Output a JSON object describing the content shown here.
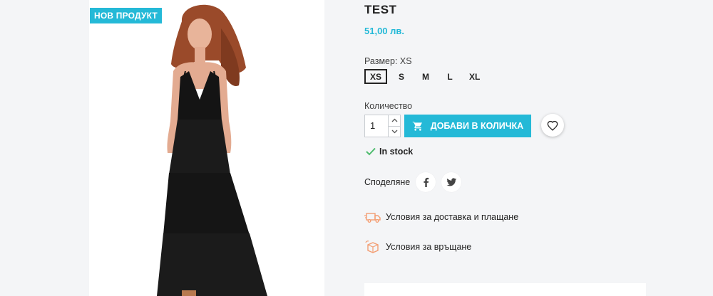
{
  "product": {
    "flag": "НОВ ПРОДУКТ",
    "title": "TEST",
    "price": "51,00 лв."
  },
  "size": {
    "label": "Размер: XS",
    "options": [
      "XS",
      "S",
      "M",
      "L",
      "XL"
    ],
    "selected": "XS"
  },
  "quantity": {
    "label": "Количество",
    "value": "1"
  },
  "cart": {
    "add_label": "ДОБАВИ В КОЛИЧКА"
  },
  "stock": {
    "label": "In stock"
  },
  "share": {
    "label": "Споделяне"
  },
  "reassurance": [
    {
      "label": "Условия за доставка и плащане"
    },
    {
      "label": "Условия за връщане"
    }
  ],
  "icons": {
    "cart": "shopping-cart-icon",
    "wishlist": "heart-icon",
    "stock": "check-icon",
    "facebook": "facebook-icon",
    "twitter": "twitter-icon",
    "delivery": "delivery-truck-icon",
    "return": "return-box-icon"
  },
  "colors": {
    "accent": "#24b9d7",
    "background": "#f4f5f7",
    "stock_check": "#4cbb6c",
    "reassurance_icon": "#f39d72"
  }
}
